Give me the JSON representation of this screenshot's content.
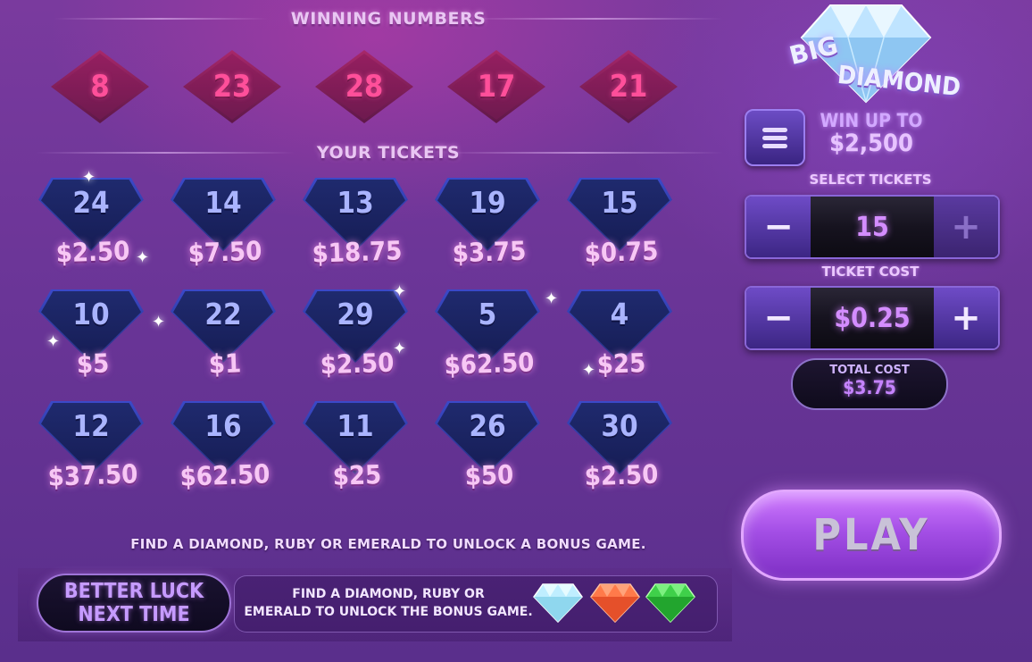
{
  "headers": {
    "winning_numbers": "WINNING NUMBERS",
    "your_tickets": "YOUR TICKETS"
  },
  "winning_numbers": [
    "8",
    "23",
    "28",
    "17",
    "21"
  ],
  "tickets": [
    {
      "number": "24",
      "prize": "$2.50"
    },
    {
      "number": "14",
      "prize": "$7.50"
    },
    {
      "number": "13",
      "prize": "$18.75"
    },
    {
      "number": "19",
      "prize": "$3.75"
    },
    {
      "number": "15",
      "prize": "$0.75"
    },
    {
      "number": "10",
      "prize": "$5"
    },
    {
      "number": "22",
      "prize": "$1"
    },
    {
      "number": "29",
      "prize": "$2.50"
    },
    {
      "number": "5",
      "prize": "$62.50"
    },
    {
      "number": "4",
      "prize": "$25"
    },
    {
      "number": "12",
      "prize": "$37.50"
    },
    {
      "number": "16",
      "prize": "$62.50"
    },
    {
      "number": "11",
      "prize": "$25"
    },
    {
      "number": "26",
      "prize": "$50"
    },
    {
      "number": "30",
      "prize": "$2.50"
    }
  ],
  "footnote": "FIND A DIAMOND, RUBY OR EMERALD TO UNLOCK A BONUS GAME.",
  "result": {
    "line1": "BETTER LUCK",
    "line2": "NEXT TIME"
  },
  "bonus": {
    "line1": "FIND A DIAMOND, RUBY OR",
    "line2": "EMERALD TO UNLOCK THE BONUS GAME.",
    "gems": [
      "diamond-icon",
      "ruby-icon",
      "emerald-icon"
    ]
  },
  "logo": {
    "word1": "BIG",
    "word2": "DIAMOND"
  },
  "win_up_to": {
    "label": "WIN UP TO",
    "amount": "$2,500"
  },
  "select_tickets": {
    "label": "SELECT TICKETS",
    "value": "15",
    "minus": "−",
    "plus": "+"
  },
  "ticket_cost": {
    "label": "TICKET COST",
    "value": "$0.25",
    "minus": "−",
    "plus": "+"
  },
  "total_cost": {
    "label": "TOTAL COST",
    "value": "$3.75"
  },
  "play_label": "PLAY",
  "colors": {
    "winning_number": "#ff4f9a",
    "ticket_number": "#aab4ff",
    "prize": "#f7c7f5",
    "accent": "#a44fe6"
  }
}
